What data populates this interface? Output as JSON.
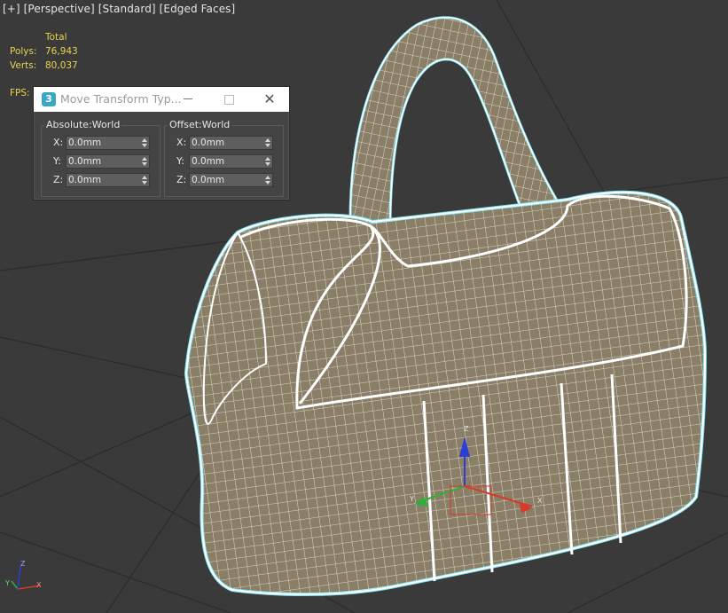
{
  "viewport": {
    "label_parts": [
      "[+]",
      "[Perspective]",
      "[Standard]",
      "[Edged Faces]"
    ],
    "background": "#3a3a3a",
    "grid_color": "#2b2b2b",
    "mesh_fill": "#8a7f66",
    "wire_color": "#ffffff",
    "selection_outline": "#7fe3f0"
  },
  "stats": {
    "header": "Total",
    "rows": [
      {
        "label": "Polys:",
        "value": "76,943"
      },
      {
        "label": "Verts:",
        "value": "80,037"
      }
    ],
    "fps_label": "FPS:"
  },
  "dialog": {
    "icon": "3",
    "title": "Move Transform Typ...",
    "absolute": {
      "title": "Absolute:World",
      "fields": [
        {
          "label": "X:",
          "value": "0.0mm"
        },
        {
          "label": "Y:",
          "value": "0.0mm"
        },
        {
          "label": "Z:",
          "value": "0.0mm"
        }
      ]
    },
    "offset": {
      "title": "Offset:World",
      "fields": [
        {
          "label": "X:",
          "value": "0.0mm"
        },
        {
          "label": "Y:",
          "value": "0.0mm"
        },
        {
          "label": "Z:",
          "value": "0.0mm"
        }
      ]
    }
  },
  "gizmo": {
    "x_label": "X",
    "y_label": "Y",
    "z_label": "Z"
  },
  "axis_tripod": {
    "x_label": "X",
    "y_label": "Y",
    "z_label": "Z"
  },
  "colors": {
    "x_axis": "#d63a2a",
    "y_axis": "#2fae3a",
    "z_axis": "#2a3ed6",
    "stats_text": "#e8d44a"
  }
}
